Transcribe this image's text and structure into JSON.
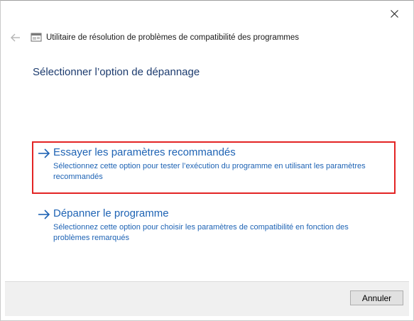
{
  "window": {
    "title": "Utilitaire de résolution de problèmes de compatibilité des programmes",
    "close_icon": "close-icon",
    "back_icon": "back-arrow-icon",
    "app_icon": "troubleshooter-app-icon"
  },
  "main": {
    "heading": "Sélectionner l’option de dépannage",
    "options": [
      {
        "title": "Essayer les paramètres recommandés",
        "description": "Sélectionnez cette option pour tester l’exécution du programme en utilisant les paramètres recommandés",
        "icon": "arrow-right-icon",
        "selected": true
      },
      {
        "title": "Dépanner le programme",
        "description": "Sélectionnez cette option pour choisir les paramètres de compatibilité en fonction des problèmes remarqués",
        "icon": "arrow-right-icon",
        "selected": false
      }
    ]
  },
  "footer": {
    "cancel_label": "Annuler"
  },
  "colors": {
    "link_blue": "#1e63b4",
    "heading_blue": "#1c3b6e",
    "highlight_red": "#e32424",
    "footer_bg": "#f0f0f0"
  }
}
